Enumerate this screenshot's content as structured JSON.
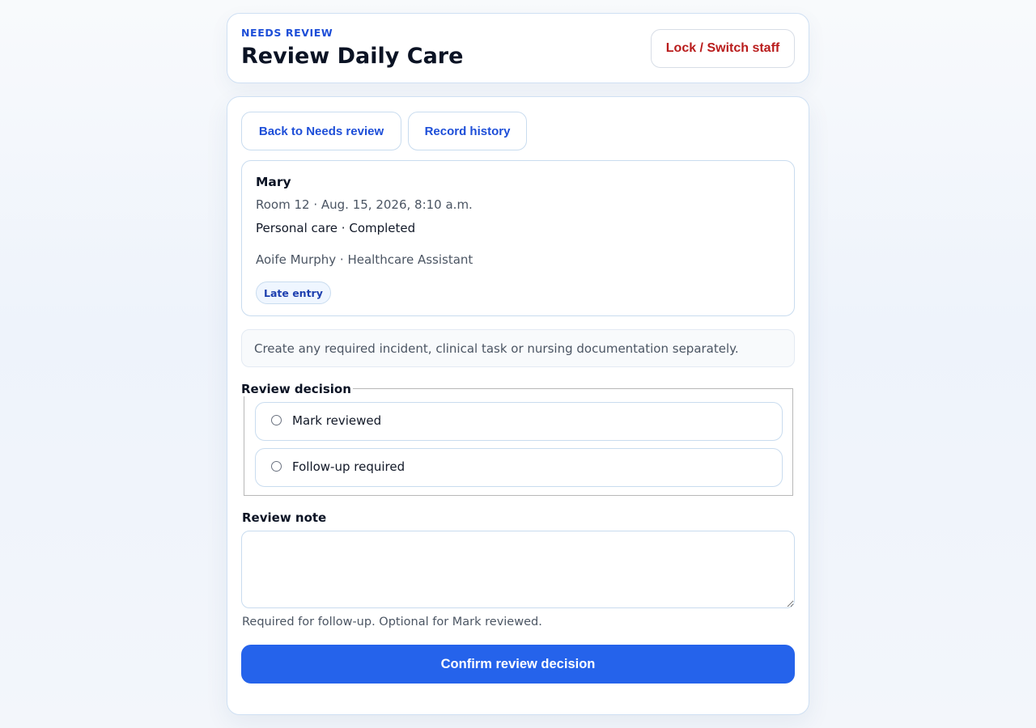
{
  "header": {
    "eyebrow": "NEEDS REVIEW",
    "title": "Review Daily Care",
    "lock_button": "Lock / Switch staff"
  },
  "nav": {
    "back_label": "Back to Needs review",
    "history_label": "Record history"
  },
  "record": {
    "resident_name": "Mary",
    "meta": "Room 12 · Aug. 15, 2026, 8:10 a.m.",
    "care_type": "Personal care · Completed",
    "staff": "Aoife Murphy · Healthcare Assistant",
    "badge": "Late entry"
  },
  "info_note": "Create any required incident, clinical task or nursing documentation separately.",
  "decision": {
    "legend": "Review decision",
    "options": [
      {
        "label": "Mark reviewed",
        "selected": false
      },
      {
        "label": "Follow-up required",
        "selected": false
      }
    ]
  },
  "note": {
    "label": "Review note",
    "value": "",
    "help": "Required for follow-up. Optional for Mark reviewed."
  },
  "confirm_button": "Confirm review decision",
  "colors": {
    "accent": "#2563eb",
    "link": "#1d4ed8",
    "danger": "#b91c1c"
  }
}
